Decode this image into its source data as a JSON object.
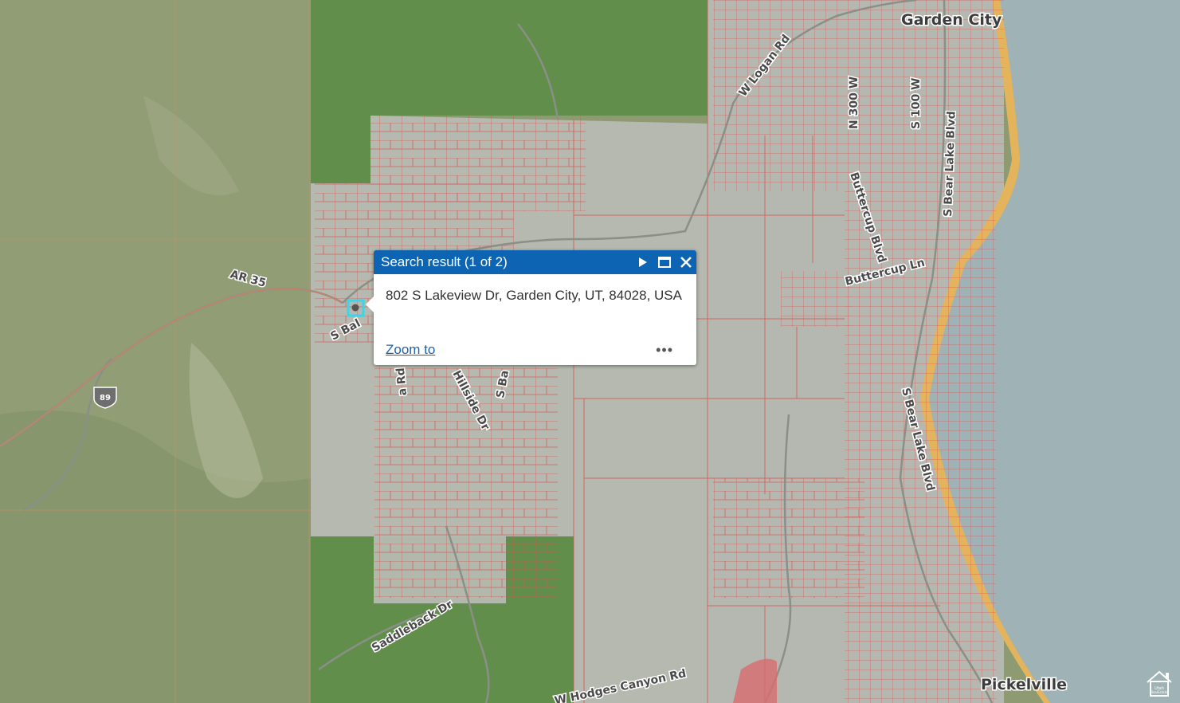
{
  "popup": {
    "title": "Search result (1 of 2)",
    "address": "802 S Lakeview Dr, Garden City, UT, 84028, USA",
    "zoom_label": "Zoom to",
    "more_label": "•••"
  },
  "map": {
    "labels": {
      "garden_city": "Garden City",
      "pickelville": "Pickelville",
      "w_logan_rd": "W Logan Rd",
      "n_300_w": "N 300 W",
      "s_100_w": "S 100 W",
      "s_bear_lake_blvd_north": "S Bear Lake Blvd",
      "buttercup_blvd": "Buttercup Blvd",
      "buttercup_ln": "Buttercup Ln",
      "s_bear_lake_blvd_south": "S Bear Lake Blvd",
      "ar_35": "AR 35",
      "s_bal": "S Bal",
      "a_rd": "a Rd",
      "hillside_dr": "Hillside Dr",
      "s_ba": "S Ba",
      "saddleback_dr": "Saddleback Dr",
      "w_hodges_canyon_rd": "W Hodges Canyon Rd"
    },
    "highway_shield": "89",
    "watermark_text": "Utah Real Estate.com",
    "colors": {
      "lake": "#9eb2b5",
      "beach": "#e5b55e",
      "parcel_line": "#d9534f",
      "forest": "#5f8a4a",
      "gray_overlay": "#b8bcb5",
      "popup_header": "#0c64b3",
      "marker": "#38d6e8"
    }
  }
}
